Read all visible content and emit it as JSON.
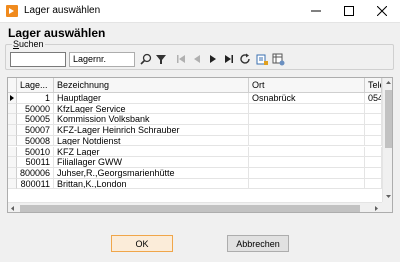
{
  "window": {
    "title": "Lager auswählen",
    "accent": "#f08a1d"
  },
  "dialog": {
    "heading": "Lager auswählen"
  },
  "search": {
    "legend_key": "S",
    "legend_rest": "uchen",
    "value": "",
    "field": "Lagernr."
  },
  "grid": {
    "columns": [
      "Lage...",
      "Bezeichnung",
      "Ort",
      "Tele"
    ],
    "rows": [
      {
        "nr": "1",
        "name": "Hauptlager",
        "ort": "Osnabrück",
        "tel": "054",
        "current": true
      },
      {
        "nr": "50000",
        "name": "KfzLager Service",
        "ort": "",
        "tel": ""
      },
      {
        "nr": "50005",
        "name": "Kommission Volksbank",
        "ort": "",
        "tel": ""
      },
      {
        "nr": "50007",
        "name": "KFZ-Lager Heinrich Schrauber",
        "ort": "",
        "tel": ""
      },
      {
        "nr": "50008",
        "name": "Lager Notdienst",
        "ort": "",
        "tel": ""
      },
      {
        "nr": "50010",
        "name": "KFZ Lager",
        "ort": "",
        "tel": ""
      },
      {
        "nr": "50011",
        "name": "Filiallager GWW",
        "ort": "",
        "tel": ""
      },
      {
        "nr": "800006",
        "name": "Juhser,R.,Georgsmarienhütte",
        "ort": "",
        "tel": ""
      },
      {
        "nr": "800011",
        "name": "Brittan,K.,London",
        "ort": "",
        "tel": ""
      }
    ]
  },
  "buttons": {
    "ok": "OK",
    "cancel": "Abbrechen"
  }
}
